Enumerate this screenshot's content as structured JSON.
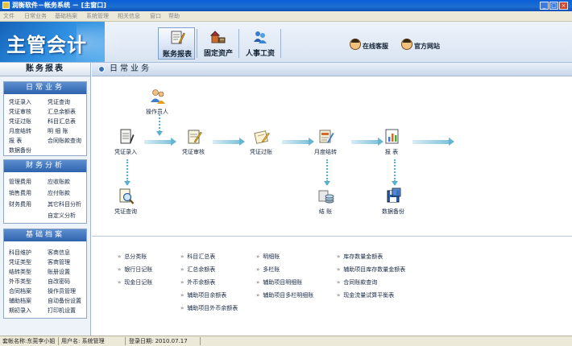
{
  "window": {
    "title": "润衡软件－帐务系统 － [主窗口]",
    "buttons": [
      "_",
      "□",
      "×"
    ]
  },
  "menu": [
    "文件",
    "日常业务",
    "基础档案",
    "系统管理",
    "相关信息",
    "窗口",
    "帮助"
  ],
  "header": {
    "logo": "主管会计",
    "tools": [
      {
        "label": "账务报表",
        "icon": "ledger-report-icon",
        "active": true
      },
      {
        "label": "固定资产",
        "icon": "fixed-assets-icon",
        "active": false
      },
      {
        "label": "人事工资",
        "icon": "payroll-icon",
        "active": false
      }
    ],
    "links": [
      {
        "label": "在线客服",
        "icon": "support-avatar-icon"
      },
      {
        "label": "官方网站",
        "icon": "website-avatar-icon"
      }
    ]
  },
  "sidebar": {
    "title": "账务报表",
    "sections": [
      {
        "title": "日常业务",
        "items": [
          "凭证录入",
          "凭证查询",
          "凭证审核",
          "汇总余额表",
          "凭证过账",
          "科目汇总表",
          "月度结转",
          "明 细 账",
          "报    表",
          "合同账款查询",
          "数据备份"
        ]
      },
      {
        "title": "财务分析",
        "items": [
          "管理费用",
          "应收账款",
          "销售费用",
          "应付账款",
          "财务费用",
          "其它科目分析",
          "自定义分析"
        ]
      },
      {
        "title": "基础档案",
        "items": [
          "科目维护",
          "客商信息",
          "凭证类型",
          "客商管理",
          "结转类型",
          "账册设置",
          "外币类型",
          "自改密码",
          "合同档案",
          "操作员管理",
          "辅助档案",
          "自动备份设置",
          "期初录入",
          "打印机设置"
        ]
      }
    ]
  },
  "main": {
    "title": "日常业务",
    "flow": [
      {
        "label": "操作员人",
        "icon": "operator-icon"
      },
      {
        "label": "凭证录入",
        "icon": "voucher-entry-icon"
      },
      {
        "label": "凭证审核",
        "icon": "voucher-audit-icon"
      },
      {
        "label": "凭证过账",
        "icon": "voucher-posting-icon"
      },
      {
        "label": "月度结转",
        "icon": "month-end-icon"
      },
      {
        "label": "报    表",
        "icon": "report-chart-icon"
      },
      {
        "label": "凭证查询",
        "icon": "voucher-query-icon"
      },
      {
        "label": "结    账",
        "icon": "closing-coins-icon"
      },
      {
        "label": "数据备份",
        "icon": "backup-floppy-icon"
      }
    ],
    "reports": [
      [
        "总分类账",
        "银行日记账",
        "现金日记账"
      ],
      [
        "科目汇总表",
        "汇总余额表",
        "外币余额表",
        "辅助项目余额表",
        "辅助项目外币余额表"
      ],
      [
        "明细账",
        "多栏账",
        "辅助项目明细账",
        "辅助项目多栏明细账"
      ],
      [
        "库存数量金额表",
        "辅助项目库存数量金额表",
        "合同账款查询",
        "现金流量试算平衡表"
      ]
    ]
  },
  "status": {
    "book": "套帐名称:东莞李小姐",
    "user": "用户名: 系统管理",
    "login": "登录日期: 2010.07.17"
  }
}
